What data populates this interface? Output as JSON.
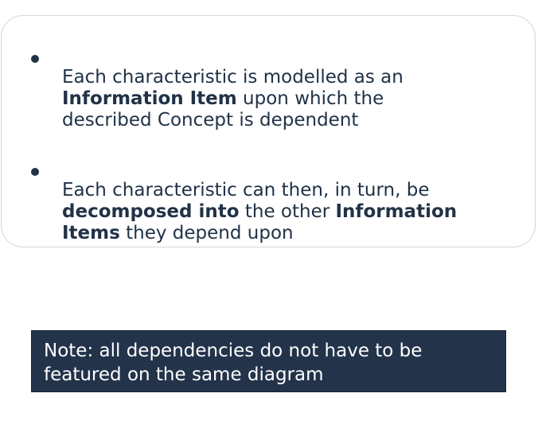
{
  "card": {
    "bullets": [
      {
        "parts": [
          {
            "text": "Each characteristic is modelled as an\n",
            "bold": false
          },
          {
            "text": "Information Item",
            "bold": true
          },
          {
            "text": " upon which the\ndescribed Concept is dependent",
            "bold": false
          }
        ]
      },
      {
        "parts": [
          {
            "text": "Each characteristic can then, in turn, be\n",
            "bold": false
          },
          {
            "text": "decomposed into",
            "bold": true
          },
          {
            "text": " the other ",
            "bold": false
          },
          {
            "text": "Information\nItems",
            "bold": true
          },
          {
            "text": " they depend upon",
            "bold": false
          }
        ]
      }
    ]
  },
  "note": {
    "line1": "Note: all dependencies do not have to be",
    "line2": "featured on the same diagram"
  },
  "colors": {
    "text": "#213247",
    "note_background": "#22334a",
    "card_border": "#d6d6d6"
  }
}
